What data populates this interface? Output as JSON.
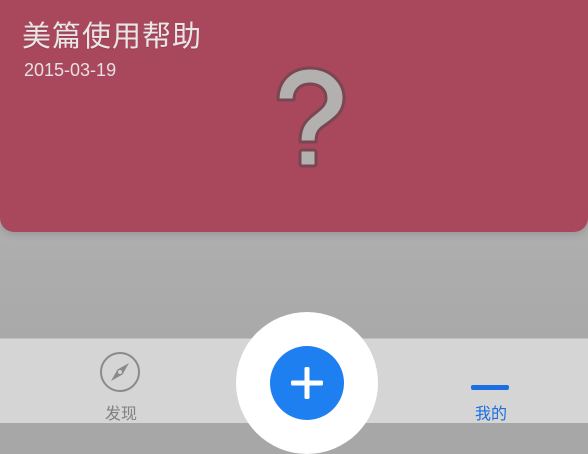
{
  "card": {
    "title": "美篇使用帮助",
    "date": "2015-03-19",
    "background_color": "#a9485d",
    "icon": "question-mark-icon"
  },
  "tabbar": {
    "tabs": [
      {
        "label": "发现",
        "icon": "compass-icon",
        "active": false
      },
      {
        "label": "我的",
        "icon": "profile-icon",
        "active": true
      }
    ],
    "add_button": {
      "icon": "plus-icon",
      "color": "#1e7ff1"
    },
    "active_color": "#1b6fe0",
    "inactive_color": "#808080"
  }
}
